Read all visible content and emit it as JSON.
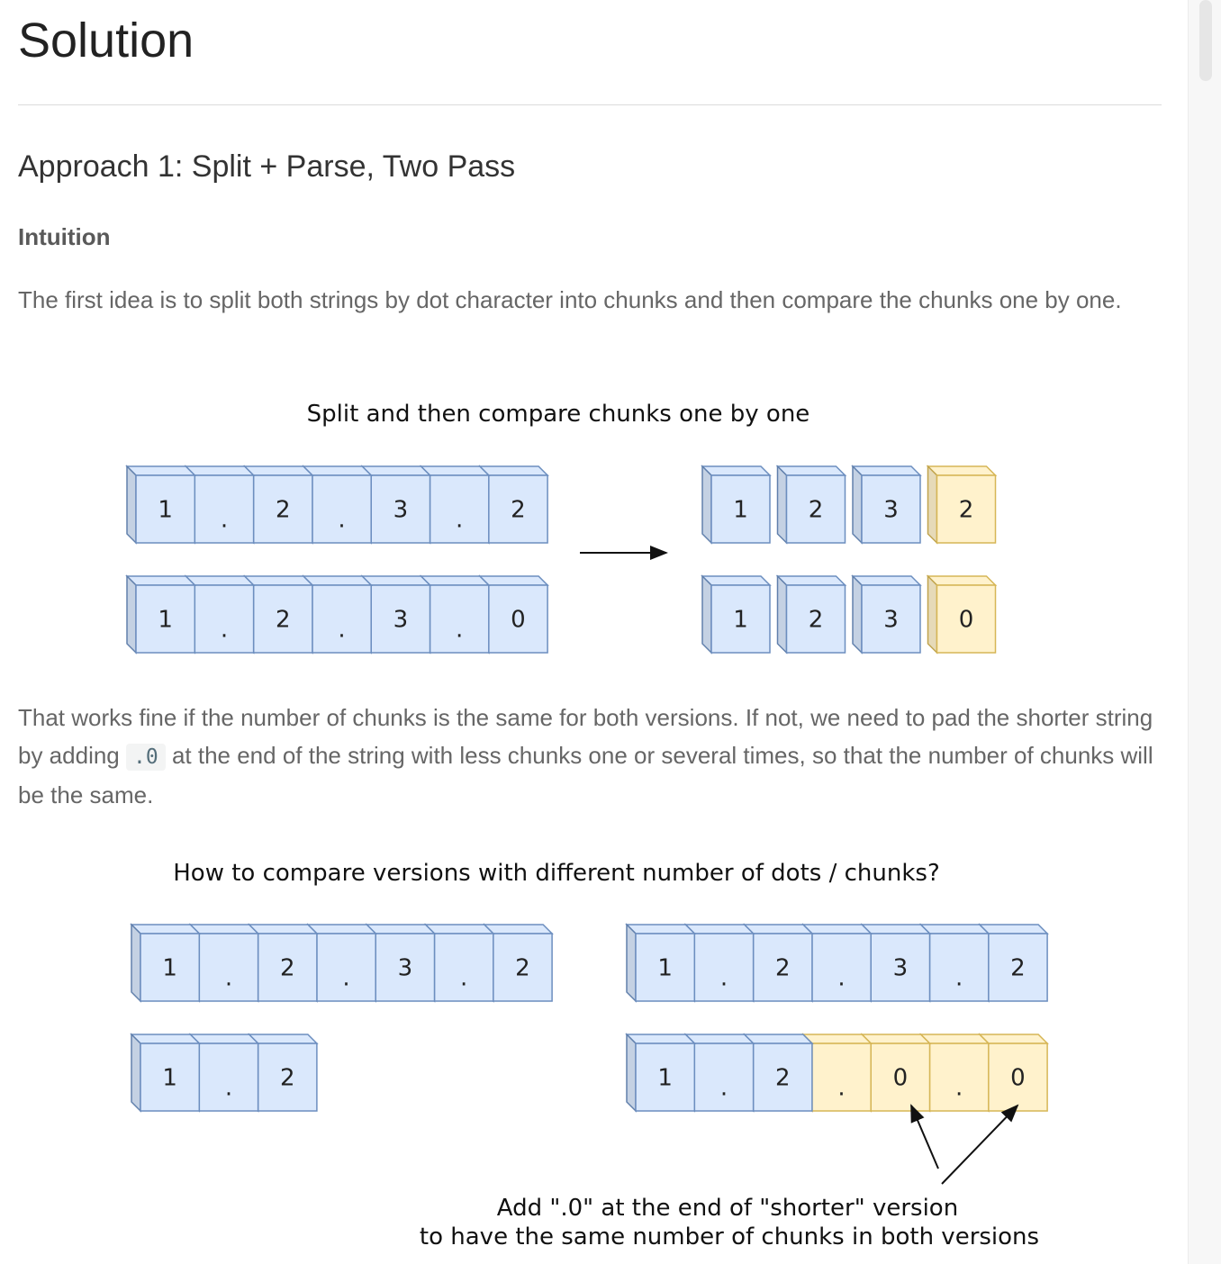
{
  "page": {
    "title": "Solution",
    "approach_heading": "Approach 1: Split + Parse, Two Pass",
    "intuition_label": "Intuition",
    "paragraph1": "The first idea is to split both strings by dot character into chunks and then compare the chunks one by one.",
    "paragraph2_before": "That works fine if the number of chunks is the same for both versions. If not, we need to pad the shorter string by adding",
    "paragraph2_code": ".0",
    "paragraph2_after": "at the end of the string with less chunks one or several times, so that the number of chunks will be the same."
  },
  "colors": {
    "blue_fill": "#dae8fc",
    "blue_stroke": "#6c8ebf",
    "yellow_fill": "#fff2cc",
    "yellow_stroke": "#d6b656"
  },
  "diagram1": {
    "title": "Split and then compare chunks one by one",
    "left_rows": [
      [
        "1",
        ".",
        "2",
        ".",
        "3",
        ".",
        "2"
      ],
      [
        "1",
        ".",
        "2",
        ".",
        "3",
        ".",
        "0"
      ]
    ],
    "right_rows": [
      [
        {
          "v": "1",
          "c": "blue"
        },
        {
          "v": "2",
          "c": "blue"
        },
        {
          "v": "3",
          "c": "blue"
        },
        {
          "v": "2",
          "c": "yellow"
        }
      ],
      [
        {
          "v": "1",
          "c": "blue"
        },
        {
          "v": "2",
          "c": "blue"
        },
        {
          "v": "3",
          "c": "blue"
        },
        {
          "v": "0",
          "c": "yellow"
        }
      ]
    ]
  },
  "diagram2": {
    "title": "How to compare versions with different number of dots / chunks?",
    "left_rows": [
      [
        "1",
        ".",
        "2",
        ".",
        "3",
        ".",
        "2"
      ],
      [
        "1",
        ".",
        "2"
      ]
    ],
    "right_rows": [
      [
        {
          "v": "1",
          "c": "blue"
        },
        {
          "v": ".",
          "c": "blue"
        },
        {
          "v": "2",
          "c": "blue"
        },
        {
          "v": ".",
          "c": "blue"
        },
        {
          "v": "3",
          "c": "blue"
        },
        {
          "v": ".",
          "c": "blue"
        },
        {
          "v": "2",
          "c": "blue"
        }
      ],
      [
        {
          "v": "1",
          "c": "blue"
        },
        {
          "v": ".",
          "c": "blue"
        },
        {
          "v": "2",
          "c": "blue"
        },
        {
          "v": ".",
          "c": "yellow"
        },
        {
          "v": "0",
          "c": "yellow"
        },
        {
          "v": ".",
          "c": "yellow"
        },
        {
          "v": "0",
          "c": "yellow"
        }
      ]
    ],
    "annotation_line1": "Add \".0\" at the end of \"shorter\" version",
    "annotation_line2": "to have the same number of chunks in both versions"
  }
}
